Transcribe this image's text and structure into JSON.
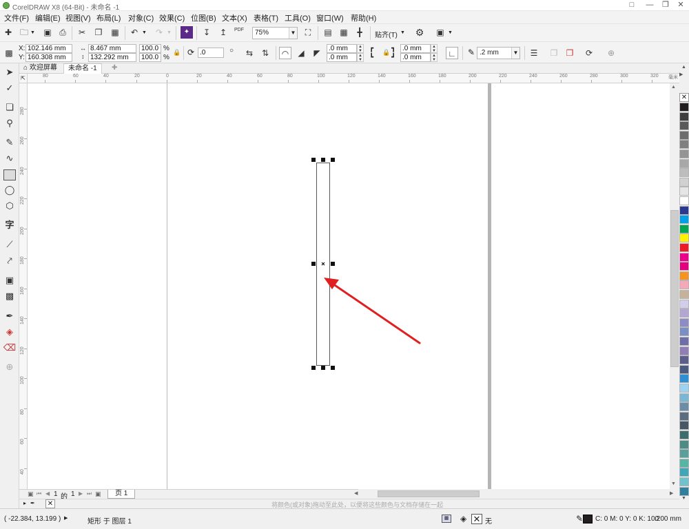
{
  "window": {
    "title": "CorelDRAW X8 (64-Bit) - 未命名 -1"
  },
  "menu": [
    "文件(F)",
    "编辑(E)",
    "视图(V)",
    "布局(L)",
    "对象(C)",
    "效果(C)",
    "位图(B)",
    "文本(X)",
    "表格(T)",
    "工具(O)",
    "窗口(W)",
    "帮助(H)"
  ],
  "toolbar": {
    "zoom": "75%",
    "pdf_label": "PDF",
    "snap_label": "贴齐(T)"
  },
  "propbar": {
    "x_label": "X:",
    "y_label": "Y:",
    "x_value": "102.146 mm",
    "y_value": "160.308 mm",
    "width_value": "8.467 mm",
    "height_value": "132.292 mm",
    "scale_x": "100.0",
    "scale_y": "100.0",
    "percent": "%",
    "rotation": ".0",
    "corner_1": ".0 mm",
    "corner_2": ".0 mm",
    "corner_3": ".0 mm",
    "corner_4": ".0 mm",
    "outline_width": ".2 mm"
  },
  "tabs": {
    "welcome": "欢迎屏幕",
    "document": "未命名 -1"
  },
  "ruler": {
    "h_labels": [
      "80",
      "60",
      "40",
      "20",
      "0",
      "20",
      "40",
      "60",
      "80",
      "100",
      "120",
      "140",
      "160",
      "180",
      "200",
      "220",
      "240",
      "260",
      "280",
      "300",
      "320"
    ],
    "h_unit": "毫米",
    "v_labels": [
      "280",
      "260",
      "240",
      "220",
      "200",
      "180",
      "160",
      "140",
      "120",
      "100",
      "80",
      "60",
      "40",
      "20"
    ]
  },
  "pagenav": {
    "current": "1",
    "of": "的",
    "total": "1",
    "page_tab": "页 1"
  },
  "docbar": {
    "hint": "将颜色(或对象)拖动至此处，以便将这些颜色与文档存储在一起"
  },
  "status": {
    "coords": "( -22.384, 13.199 )",
    "object_info": "矩形 于 图层 1",
    "fill_none": "无",
    "outline_color": "C: 0 M: 0 Y: 0 K: 100",
    "outline_width": ".200 mm"
  },
  "palette": [
    "#231f20",
    "#3e3e3e",
    "#595959",
    "#6d6d6d",
    "#7f7f7f",
    "#949494",
    "#a8a8a8",
    "#bdbdbd",
    "#d1d1d1",
    "#e6e6e6",
    "#ffffff",
    "#2b3990",
    "#00a0e9",
    "#00a651",
    "#fff200",
    "#ed1c24",
    "#ec008c",
    "#e4007f",
    "#f7941d",
    "#f4a8b8",
    "#c7b299",
    "#d2cde8",
    "#b3a6d4",
    "#8c8cc7",
    "#7b8fc7",
    "#6e6ea9",
    "#8f7fb6",
    "#5d5d8c",
    "#4a5a80",
    "#2d8fd4",
    "#9bd3f0",
    "#7ab6d6",
    "#6b8da8",
    "#5a6e80",
    "#485765",
    "#3c6e6e",
    "#4d8c84",
    "#5aa09a",
    "#55b6a6",
    "#3fa7b8",
    "#6ec3cc",
    "#2f7f9e"
  ],
  "colors": {
    "arrow": "#e02020",
    "palette_selected": "#231f20"
  }
}
